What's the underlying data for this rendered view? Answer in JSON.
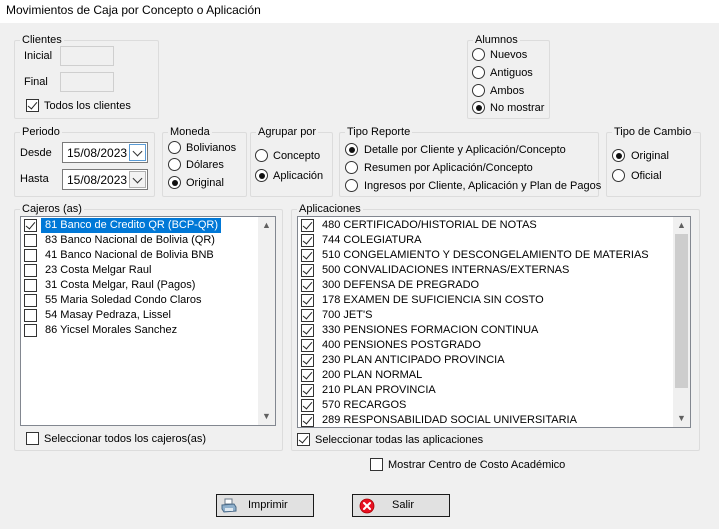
{
  "window": {
    "title": "Movimientos de Caja por Concepto o Aplicación"
  },
  "clientes": {
    "legend": "Clientes",
    "inicial_label": "Inicial",
    "final_label": "Final",
    "todos_label": "Todos los clientes",
    "todos_checked": true
  },
  "alumnos": {
    "legend": "Alumnos",
    "options": [
      "Nuevos",
      "Antiguos",
      "Ambos",
      "No mostrar"
    ],
    "selected": "No mostrar"
  },
  "periodo": {
    "legend": "Periodo",
    "desde_label": "Desde",
    "desde_value": "15/08/2023",
    "hasta_label": "Hasta",
    "hasta_value": "15/08/2023"
  },
  "moneda": {
    "legend": "Moneda",
    "options": [
      "Bolivianos",
      "Dólares",
      "Original"
    ],
    "selected": "Original"
  },
  "agrupar": {
    "legend": "Agrupar por",
    "options": [
      "Concepto",
      "Aplicación"
    ],
    "selected": "Aplicación"
  },
  "tipo_reporte": {
    "legend": "Tipo Reporte",
    "options": [
      "Detalle por Cliente y Aplicación/Concepto",
      "Resumen por Aplicación/Concepto",
      "Ingresos por Cliente, Aplicación y Plan de Pagos"
    ],
    "selected": "Detalle por Cliente y Aplicación/Concepto"
  },
  "tipo_cambio": {
    "legend": "Tipo de Cambio",
    "options": [
      "Original",
      "Oficial"
    ],
    "selected": "Original"
  },
  "cajeros": {
    "legend": "Cajeros (as)",
    "items": [
      {
        "label": "81 Banco de Credito QR (BCP-QR)",
        "checked": true,
        "selected": true
      },
      {
        "label": "83 Banco Nacional de Bolivia (QR)",
        "checked": false,
        "selected": false
      },
      {
        "label": "41 Banco Nacional de Bolivia BNB",
        "checked": false,
        "selected": false
      },
      {
        "label": "23 Costa Melgar Raul",
        "checked": false,
        "selected": false
      },
      {
        "label": "31 Costa Melgar, Raul (Pagos)",
        "checked": false,
        "selected": false
      },
      {
        "label": "55 Maria Soledad Condo Claros",
        "checked": false,
        "selected": false
      },
      {
        "label": "54 Masay Pedraza, Lissel",
        "checked": false,
        "selected": false
      },
      {
        "label": "86 Yicsel Morales Sanchez",
        "checked": false,
        "selected": false
      }
    ],
    "select_all_label": "Seleccionar todos los cajeros(as)",
    "select_all_checked": false
  },
  "aplicaciones": {
    "legend": "Aplicaciones",
    "items": [
      {
        "label": "480 CERTIFICADO/HISTORIAL DE NOTAS",
        "checked": true
      },
      {
        "label": "744 COLEGIATURA",
        "checked": true
      },
      {
        "label": "510 CONGELAMIENTO Y DESCONGELAMIENTO DE MATERIAS",
        "checked": true
      },
      {
        "label": "500 CONVALIDACIONES INTERNAS/EXTERNAS",
        "checked": true
      },
      {
        "label": "300 DEFENSA DE PREGRADO",
        "checked": true
      },
      {
        "label": "178 EXAMEN DE SUFICIENCIA SIN COSTO",
        "checked": true
      },
      {
        "label": "700 JET'S",
        "checked": true
      },
      {
        "label": "330 PENSIONES FORMACION CONTINUA",
        "checked": true
      },
      {
        "label": "400 PENSIONES POSTGRADO",
        "checked": true
      },
      {
        "label": "230 PLAN ANTICIPADO PROVINCIA",
        "checked": true
      },
      {
        "label": "200 PLAN NORMAL",
        "checked": true
      },
      {
        "label": "210 PLAN PROVINCIA",
        "checked": true
      },
      {
        "label": "570 RECARGOS",
        "checked": true
      },
      {
        "label": "289 RESPONSABILIDAD SOCIAL UNIVERSITARIA",
        "checked": true
      }
    ],
    "select_all_label": "Seleccionar todas las aplicaciones",
    "select_all_checked": true
  },
  "centro_costo": {
    "label": "Mostrar Centro de Costo Académico",
    "checked": false
  },
  "buttons": {
    "imprimir": "Imprimir",
    "salir": "Salir"
  },
  "icons": {
    "printer": "printer-icon",
    "exit": "exit-icon",
    "calendar_dropdown": "chevron-down-icon",
    "scroll_up": "scroll-up-arrow-icon",
    "scroll_down": "scroll-down-arrow-icon"
  },
  "colors": {
    "selection": "#0078d7",
    "window_bg": "#f0f0f0",
    "exit_icon": "#e81123"
  }
}
